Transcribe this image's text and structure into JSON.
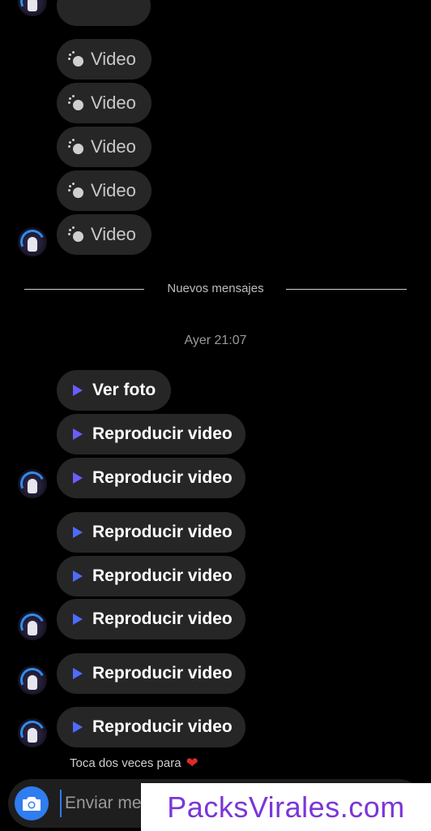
{
  "messages_top": [
    {
      "label": "Video"
    },
    {
      "label": "Video"
    },
    {
      "label": "Video"
    },
    {
      "label": "Video"
    },
    {
      "label": "Video"
    }
  ],
  "divider": {
    "label": "Nuevos mensajes"
  },
  "timestamp": "Ayer 21:07",
  "messages_new": [
    {
      "label": "Ver foto",
      "icon": "play-icon"
    },
    {
      "label": "Reproducir video",
      "icon": "play-icon"
    },
    {
      "label": "Reproducir video",
      "icon": "play-icon"
    },
    {
      "label": "Reproducir video",
      "icon": "play-icon"
    },
    {
      "label": "Reproducir video",
      "icon": "play-icon"
    },
    {
      "label": "Reproducir video",
      "icon": "play-icon"
    },
    {
      "label": "Reproducir video",
      "icon": "play-icon"
    },
    {
      "label": "Reproducir video",
      "icon": "play-icon"
    }
  ],
  "hint": {
    "text": "Toca dos veces para",
    "icon": "heart-icon"
  },
  "composer": {
    "placeholder": "Enviar mensaje...",
    "camera_icon": "camera-icon"
  },
  "watermark": "PacksVirales.com",
  "colors": {
    "background": "#000000",
    "bubble": "#262626",
    "accent_blue": "#2f7df0",
    "play_purple": "#6a5cff",
    "heart": "#e02a2a",
    "watermark_text": "#7a36d8"
  }
}
